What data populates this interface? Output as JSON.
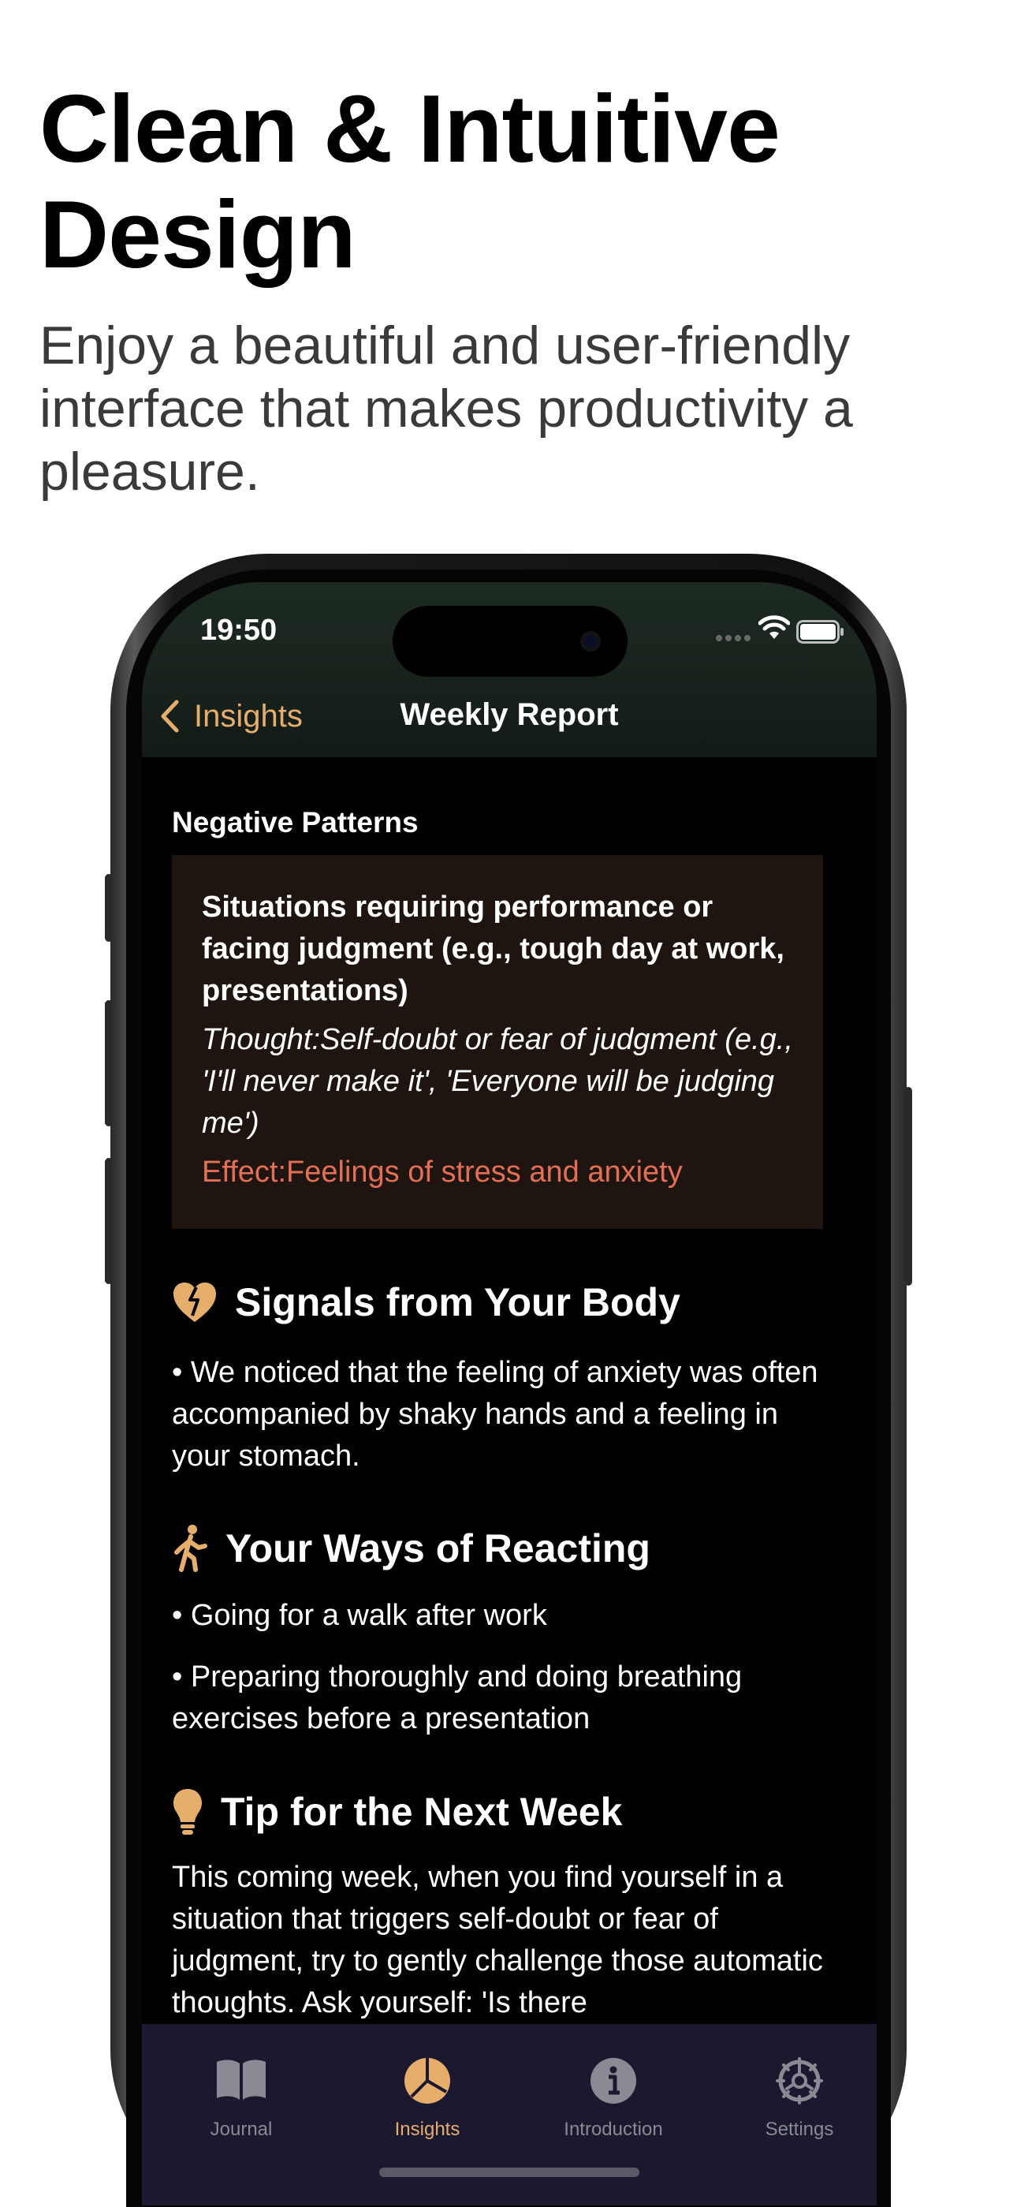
{
  "headline": "Clean & Intuitive Design",
  "subline": "Enjoy a beautiful and user-friendly interface that makes productivity a pleasure.",
  "status_bar": {
    "time": "19:50"
  },
  "nav": {
    "back_label": "Insights",
    "title": "Weekly Report"
  },
  "negative_patterns": {
    "label": "Negative Patterns",
    "situation": "Situations requiring performance or facing judgment (e.g., tough day at work, presentations)",
    "thought": "Thought:Self-doubt or fear of judgment (e.g., 'I'll never make it', 'Everyone will be judging me')",
    "effect": "Effect:Feelings of stress and anxiety"
  },
  "body_signals": {
    "title": "Signals from Your Body",
    "icon": "broken-heart-icon",
    "items": [
      "• We noticed that the feeling of anxiety was often accompanied by shaky hands and a feeling in your stomach."
    ]
  },
  "reacting": {
    "title": "Your Ways of Reacting",
    "icon": "walking-figure-icon",
    "items": [
      "• Going for a walk after work",
      "• Preparing thoroughly and doing breathing exercises before a presentation"
    ]
  },
  "tip": {
    "title": "Tip for the Next Week",
    "icon": "lightbulb-icon",
    "text": "This coming week, when you find yourself in a situation that triggers self-doubt or fear of judgment, try to gently challenge those automatic thoughts. Ask yourself: 'Is there"
  },
  "tabs": [
    {
      "label": "Journal",
      "icon": "book-icon",
      "active": false
    },
    {
      "label": "Insights",
      "icon": "pie-chart-icon",
      "active": true
    },
    {
      "label": "Introduction",
      "icon": "info-icon",
      "active": false
    },
    {
      "label": "Settings",
      "icon": "gear-icon",
      "active": false
    }
  ],
  "colors": {
    "accent": "#e6ae6b",
    "effect_text": "#e46f52",
    "card_background": "#1e1510",
    "tabbar_background": "#1a1930"
  }
}
